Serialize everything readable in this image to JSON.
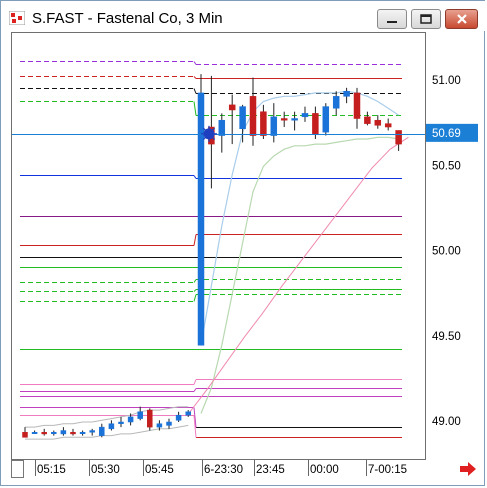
{
  "window": {
    "title": "S.FAST - Fastenal Co, 3 Min",
    "minimize_label": "minimize",
    "maximize_label": "maximize",
    "close_label": "close"
  },
  "price_axis": {
    "labels": [
      "51.00",
      "50.50",
      "50.00",
      "49.50",
      "49.00"
    ],
    "current_price": "50.69",
    "current_price_color": "#1c7fd6"
  },
  "time_axis": {
    "labels": [
      "05:15",
      "05:30",
      "05:45",
      "6-23:30",
      "23:45",
      "00:00",
      "7-00:15"
    ]
  },
  "colors": {
    "up_candle": "#1b72d8",
    "down_candle": "#c41e1e",
    "ma_pink": "#f08ab0",
    "band_light_blue": "#a9cdea",
    "band_light_green": "#b8d9b0",
    "scroll_arrow": "#e02020"
  },
  "chart_data": {
    "type": "candlestick",
    "title": "S.FAST - Fastenal Co, 3 Min",
    "ylim": [
      48.92,
      51.12
    ],
    "yticks": [
      51.0,
      50.5,
      50.0,
      49.5,
      49.0
    ],
    "current_price": 50.69,
    "session1_candles": [
      {
        "o": 48.94,
        "h": 48.97,
        "l": 48.91,
        "c": 48.91
      },
      {
        "o": 48.94,
        "h": 48.95,
        "l": 48.93,
        "c": 48.94
      },
      {
        "o": 48.94,
        "h": 48.96,
        "l": 48.92,
        "c": 48.93
      },
      {
        "o": 48.94,
        "h": 48.95,
        "l": 48.92,
        "c": 48.94
      },
      {
        "o": 48.93,
        "h": 48.97,
        "l": 48.92,
        "c": 48.95
      },
      {
        "o": 48.94,
        "h": 48.96,
        "l": 48.92,
        "c": 48.93
      },
      {
        "o": 48.94,
        "h": 48.95,
        "l": 48.92,
        "c": 48.94
      },
      {
        "o": 48.94,
        "h": 48.96,
        "l": 48.92,
        "c": 48.95
      },
      {
        "o": 48.92,
        "h": 48.99,
        "l": 48.91,
        "c": 48.97
      },
      {
        "o": 48.96,
        "h": 49.01,
        "l": 48.95,
        "c": 48.99
      },
      {
        "o": 48.99,
        "h": 49.03,
        "l": 48.97,
        "c": 49.0
      },
      {
        "o": 49.0,
        "h": 49.05,
        "l": 48.98,
        "c": 49.03
      },
      {
        "o": 49.02,
        "h": 49.09,
        "l": 49.01,
        "c": 49.06
      },
      {
        "o": 49.07,
        "h": 49.08,
        "l": 48.95,
        "c": 48.97
      },
      {
        "o": 48.97,
        "h": 49.01,
        "l": 48.95,
        "c": 48.99
      },
      {
        "o": 48.98,
        "h": 49.02,
        "l": 48.96,
        "c": 49.0
      },
      {
        "o": 49.01,
        "h": 49.06,
        "l": 49.0,
        "c": 49.04
      },
      {
        "o": 49.04,
        "h": 49.07,
        "l": 49.03,
        "c": 49.06
      }
    ],
    "session2_candles": [
      {
        "o": 49.45,
        "h": 51.04,
        "l": 49.45,
        "c": 50.93
      },
      {
        "o": 50.73,
        "h": 51.03,
        "l": 50.37,
        "c": 50.63
      },
      {
        "o": 50.68,
        "h": 50.81,
        "l": 50.58,
        "c": 50.77
      },
      {
        "o": 50.86,
        "h": 50.92,
        "l": 50.63,
        "c": 50.83
      },
      {
        "o": 50.72,
        "h": 50.86,
        "l": 50.64,
        "c": 50.85
      },
      {
        "o": 50.91,
        "h": 51.02,
        "l": 50.62,
        "c": 50.68
      },
      {
        "o": 50.82,
        "h": 50.86,
        "l": 50.66,
        "c": 50.68
      },
      {
        "o": 50.68,
        "h": 50.87,
        "l": 50.64,
        "c": 50.79
      },
      {
        "o": 50.78,
        "h": 50.82,
        "l": 50.73,
        "c": 50.77
      },
      {
        "o": 50.77,
        "h": 50.82,
        "l": 50.71,
        "c": 50.78
      },
      {
        "o": 50.79,
        "h": 50.85,
        "l": 50.76,
        "c": 50.81
      },
      {
        "o": 50.81,
        "h": 50.85,
        "l": 50.66,
        "c": 50.69
      },
      {
        "o": 50.7,
        "h": 50.87,
        "l": 50.68,
        "c": 50.85
      },
      {
        "o": 50.84,
        "h": 50.94,
        "l": 50.8,
        "c": 50.91
      },
      {
        "o": 50.91,
        "h": 50.96,
        "l": 50.87,
        "c": 50.94
      },
      {
        "o": 50.93,
        "h": 50.96,
        "l": 50.72,
        "c": 50.78
      },
      {
        "o": 50.79,
        "h": 50.82,
        "l": 50.74,
        "c": 50.75
      },
      {
        "o": 50.77,
        "h": 50.8,
        "l": 50.72,
        "c": 50.74
      },
      {
        "o": 50.75,
        "h": 50.78,
        "l": 50.71,
        "c": 50.73
      },
      {
        "o": 50.71,
        "h": 50.71,
        "l": 50.59,
        "c": 50.63
      }
    ],
    "pivot_levels_left": [
      {
        "v": 51.12,
        "color": "#9b30d8",
        "dash": true
      },
      {
        "v": 51.03,
        "color": "#cc2222",
        "dash": true
      },
      {
        "v": 50.96,
        "color": "#111111",
        "dash": true
      },
      {
        "v": 50.88,
        "color": "#22bb22",
        "dash": true
      },
      {
        "v": 50.45,
        "color": "#1133dd",
        "dash": false
      },
      {
        "v": 50.21,
        "color": "#881a88",
        "dash": false
      },
      {
        "v": 50.04,
        "color": "#cc2222",
        "dash": false
      },
      {
        "v": 49.97,
        "color": "#111111",
        "dash": false
      },
      {
        "v": 49.91,
        "color": "#22bb22",
        "dash": false
      },
      {
        "v": 49.82,
        "color": "#22bb22",
        "dash": true
      },
      {
        "v": 49.77,
        "color": "#22bb22",
        "dash": true
      },
      {
        "v": 49.71,
        "color": "#22bb22",
        "dash": true
      },
      {
        "v": 49.43,
        "color": "#22bb22",
        "dash": false
      },
      {
        "v": 49.22,
        "color": "#f07cc0",
        "dash": false
      },
      {
        "v": 49.18,
        "color": "#c040c0",
        "dash": false
      },
      {
        "v": 49.15,
        "color": "#c040c0",
        "dash": false
      },
      {
        "v": 49.09,
        "color": "#c040c0",
        "dash": false
      },
      {
        "v": 49.04,
        "color": "#f07cc0",
        "dash": false
      }
    ],
    "pivot_levels_right": [
      {
        "v": 51.1,
        "color": "#9b30d8",
        "dash": true
      },
      {
        "v": 51.02,
        "color": "#cc2222",
        "dash": false
      },
      {
        "v": 50.93,
        "color": "#111111",
        "dash": true
      },
      {
        "v": 50.8,
        "color": "#22bb22",
        "dash": true
      },
      {
        "v": 50.43,
        "color": "#1133dd",
        "dash": false
      },
      {
        "v": 50.21,
        "color": "#881a88",
        "dash": false
      },
      {
        "v": 50.1,
        "color": "#cc2222",
        "dash": false
      },
      {
        "v": 49.97,
        "color": "#111111",
        "dash": false
      },
      {
        "v": 49.91,
        "color": "#22bb22",
        "dash": false
      },
      {
        "v": 49.84,
        "color": "#22bb22",
        "dash": true
      },
      {
        "v": 49.78,
        "color": "#22bb22",
        "dash": false
      },
      {
        "v": 49.75,
        "color": "#22bb22",
        "dash": true
      },
      {
        "v": 49.43,
        "color": "#22bb22",
        "dash": false
      },
      {
        "v": 49.25,
        "color": "#f07cc0",
        "dash": false
      },
      {
        "v": 49.2,
        "color": "#c040c0",
        "dash": false
      },
      {
        "v": 49.15,
        "color": "#c040c0",
        "dash": false
      },
      {
        "v": 48.97,
        "color": "#111111",
        "dash": false
      },
      {
        "v": 48.91,
        "color": "#cc2222",
        "dash": false
      }
    ],
    "ma_pink": [
      49.06,
      49.2,
      49.35,
      49.5,
      49.64,
      49.79,
      49.93,
      50.07,
      50.21,
      50.35,
      50.49,
      50.6,
      50.67
    ]
  }
}
